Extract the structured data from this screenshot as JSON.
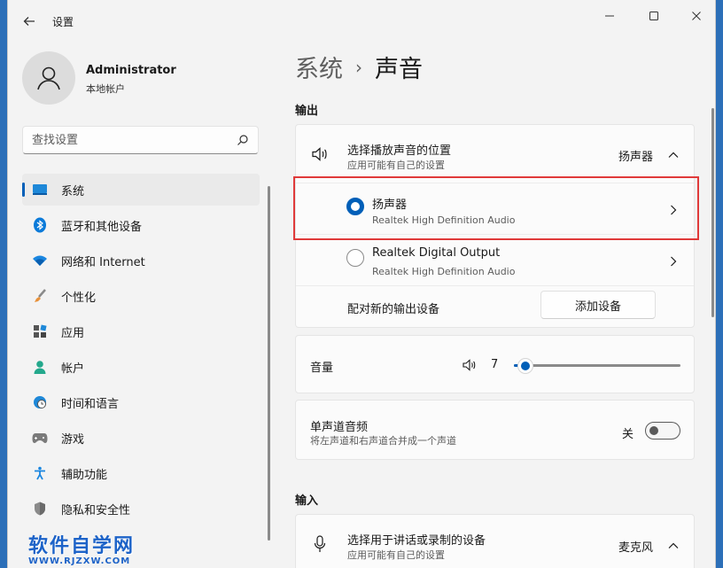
{
  "window": {
    "title": "设置",
    "controls": [
      "minimize-icon",
      "maximize-icon",
      "close-icon"
    ]
  },
  "user": {
    "name": "Administrator",
    "account_type": "本地帐户"
  },
  "search": {
    "placeholder": "查找设置"
  },
  "sidebar": {
    "items": [
      {
        "label": "系统",
        "icon": "system-icon",
        "active": true
      },
      {
        "label": "蓝牙和其他设备",
        "icon": "bluetooth-icon"
      },
      {
        "label": "网络和 Internet",
        "icon": "wifi-icon"
      },
      {
        "label": "个性化",
        "icon": "brush-icon"
      },
      {
        "label": "应用",
        "icon": "apps-icon"
      },
      {
        "label": "帐户",
        "icon": "person-icon"
      },
      {
        "label": "时间和语言",
        "icon": "clock-globe-icon"
      },
      {
        "label": "游戏",
        "icon": "gamepad-icon"
      },
      {
        "label": "辅助功能",
        "icon": "accessibility-icon"
      },
      {
        "label": "隐私和安全性",
        "icon": "shield-icon"
      }
    ]
  },
  "breadcrumb": {
    "parent": "系统",
    "separator": "›",
    "current": "声音"
  },
  "output": {
    "section_title": "输出",
    "choose_title": "选择播放声音的位置",
    "choose_subtitle": "应用可能有自己的设置",
    "choose_value": "扬声器",
    "devices": [
      {
        "name": "扬声器",
        "detail": "Realtek High Definition Audio",
        "selected": true
      },
      {
        "name": "Realtek Digital Output",
        "detail": "Realtek High Definition Audio",
        "selected": false
      }
    ],
    "pair_label": "配对新的输出设备",
    "add_device_button": "添加设备"
  },
  "volume": {
    "label": "音量",
    "value": "7",
    "fraction": 0.07
  },
  "mono": {
    "title": "单声道音频",
    "subtitle": "将左声道和右声道合并成一个声道",
    "state_label": "关",
    "on": false
  },
  "input": {
    "section_title": "输入",
    "choose_title": "选择用于讲话或录制的设备",
    "choose_subtitle": "应用可能有自己的设置",
    "choose_value": "麦克风"
  },
  "watermark": {
    "main": "软件自学网",
    "sub": "WWW.RJZXW.COM"
  },
  "colors": {
    "accent": "#005fb8",
    "highlight_box": "#e03a3a",
    "watermark": "#1d63c8"
  }
}
